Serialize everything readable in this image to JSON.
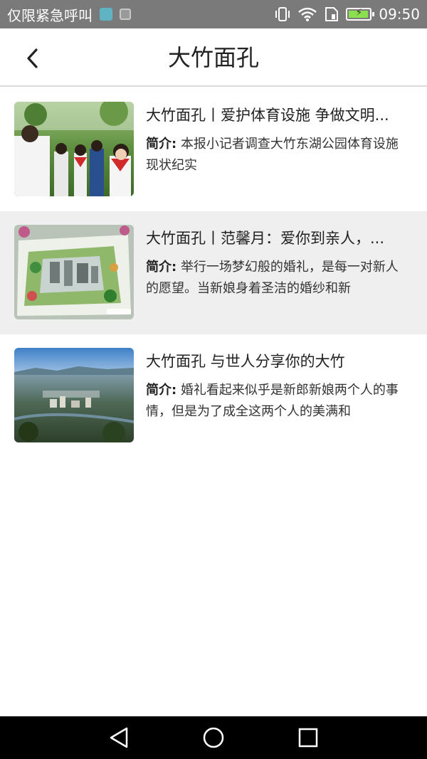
{
  "status_bar": {
    "carrier_text": "仅限紧急呼叫",
    "time": "09:50",
    "battery_level": 0.85,
    "icons": [
      "app-notification-icon",
      "image-notification-icon",
      "vibrate-icon",
      "wifi-icon",
      "sim-icon",
      "battery-charging-icon"
    ]
  },
  "header": {
    "title": "大竹面孔",
    "back_icon": "chevron-left-icon"
  },
  "articles": [
    {
      "title": "大竹面孔丨爱护体育设施 争做文明...",
      "summary_label": "简介:",
      "summary": "本报小记者调查大竹东湖公园体育设施现状纪实",
      "thumbnail": "students-outdoor-photo",
      "selected": false
    },
    {
      "title": "大竹面孔丨范馨月：爱你到亲人，...",
      "summary_label": "简介:",
      "summary": "举行一场梦幻般的婚礼，是每一对新人的愿望。当新娘身着圣洁的婚纱和新",
      "thumbnail": "map-painting-photo",
      "selected": true
    },
    {
      "title": "大竹面孔 与世人分享你的大竹",
      "summary_label": "简介:",
      "summary": "婚礼看起来似乎是新郎新娘两个人的事情，但是为了成全这两个人的美满和",
      "thumbnail": "city-aerial-photo",
      "selected": false
    }
  ],
  "nav_bar": {
    "icons": [
      "back-triangle-icon",
      "home-circle-icon",
      "recents-square-icon"
    ]
  },
  "colors": {
    "status_bar_bg": "#7a7a7a",
    "selected_row_bg": "#efefef",
    "nav_bar_bg": "#000000",
    "divider": "#d9d9d9"
  }
}
